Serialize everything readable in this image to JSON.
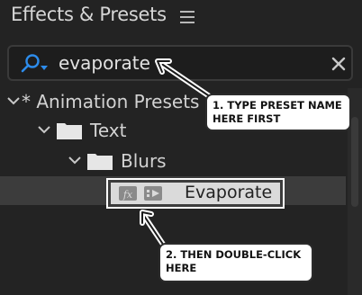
{
  "panel": {
    "title": "Effects & Presets",
    "menu_icon": "hamburger-menu-icon"
  },
  "search": {
    "value": "evaporate",
    "icon": "search-icon",
    "clear_icon": "close-icon"
  },
  "tree": {
    "items": [
      {
        "label": "* Animation Presets",
        "expanded": true
      },
      {
        "label": "Text",
        "expanded": true
      },
      {
        "label": "Blurs",
        "expanded": true
      }
    ],
    "preset": {
      "label": "Evaporate",
      "icons": [
        "fx-preset-icon",
        "animation-preset-icon"
      ],
      "selected": true
    }
  },
  "callouts": [
    {
      "line1": "1. TYPE PRESET NAME",
      "line2": "HERE FIRST"
    },
    {
      "line1": "2. THEN DOUBLE-CLICK",
      "line2": "HERE"
    }
  ],
  "colors": {
    "panel_bg": "#232323",
    "search_icon": "#2d8ceb",
    "selected_row": "#3c3c3c",
    "highlight_border": "#ffffff"
  }
}
